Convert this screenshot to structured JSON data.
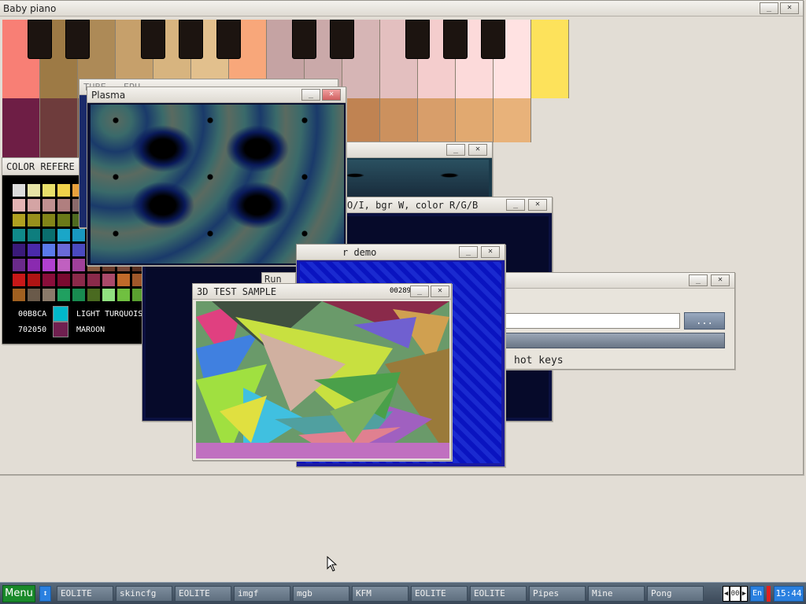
{
  "piano": {
    "title": "Baby piano",
    "white_keys": [
      "#f87f75",
      "#9d7a45",
      "#ad8a57",
      "#c6a06b",
      "#d7b47f",
      "#e2c08d",
      "#f8a77a",
      "#c5a3a3",
      "#caa9a9",
      "#d6b5b5",
      "#e3bfbf",
      "#f4cdcd",
      "#fcdada",
      "#ffe2e2",
      "#fde25b"
    ],
    "lower_keys": [
      "#6e1e45",
      "#6e3c3c",
      "#774a3a",
      "#864f32",
      "#8a5430",
      "#935b34",
      "#a0653a",
      "#a96d3c",
      "#b47746",
      "#c08352",
      "#cc915e",
      "#d89e6a",
      "#e1a970",
      "#e8b27a"
    ]
  },
  "color_ref": {
    "title": "COLOR REFERE",
    "grid": [
      [
        "#dcdcdc",
        "#e5e3a6",
        "#e8df6a",
        "#f0d24a",
        "#e8a03c"
      ],
      [
        "#e4b4b4",
        "#d4a4a4",
        "#c09090",
        "#b07f7f",
        "#8a6a6a"
      ],
      [
        "#b0a020",
        "#98901c",
        "#828418",
        "#6a7a18",
        "#4f6a20"
      ],
      [
        "#108a8a",
        "#0e7e7e",
        "#0a6e6e",
        "#1aa6c8",
        "#1898c0"
      ],
      [
        "#3a1a7a",
        "#4a2aaa",
        "#5a7aea",
        "#6a6ad8",
        "#4a4ac0"
      ],
      [
        "#6a2a8a",
        "#8a2ab0",
        "#b040d0",
        "#c060c0",
        "#a0409a"
      ],
      [
        "#c81818",
        "#b01414",
        "#8a0e3a",
        "#7a0a30",
        "#8a2a4a"
      ],
      [
        "#a06020",
        "#6a5a4a",
        "#8a7a6a",
        "#20a060",
        "#188a50"
      ]
    ],
    "extra_swatches": [
      [
        "#8a5a40",
        "#6a3a2a",
        "#7a4a3a",
        "#5a3020"
      ],
      [
        "#8a2a4a",
        "#aa4a6a",
        "#c06a2a",
        "#a0582a"
      ],
      [
        "#4a6a20",
        "#90e080",
        "#70c040",
        "#5aa030"
      ]
    ],
    "row1_hex": "00B8CA",
    "row1_color": "#00b8ca",
    "row1_name": "LIGHT TURQUOISE",
    "row2_hex": "702050",
    "row2_color": "#702050",
    "row2_name": "MAROON"
  },
  "tube_window": {
    "title": "TUBE - FPU"
  },
  "plasma": {
    "title": "Plasma"
  },
  "bgr_window": {
    "title": "O/I, bgr W, color R/G/B"
  },
  "demo_window": {
    "title": "r demo"
  },
  "run_label": "Run",
  "dialog": {
    "browse_label": "...",
    "hotkeys_text": "hot keys",
    "input_value": ""
  },
  "test3d": {
    "title": "3D TEST SAMPLE",
    "counter": "00289"
  },
  "taskbar": {
    "menu_label": "Menu",
    "tasks": [
      "EOLITE",
      "skincfg",
      "EOLITE",
      "imgf",
      "mgb",
      "KFM",
      "EOLITE",
      "EOLITE",
      "Pipes",
      "Mine",
      "Pong"
    ],
    "desktop_num": "00",
    "lang": "En",
    "clock": "15:44"
  },
  "colors": {
    "taskbar_menu": "#1a8a2a",
    "clock_bg": "#2a80e0"
  }
}
